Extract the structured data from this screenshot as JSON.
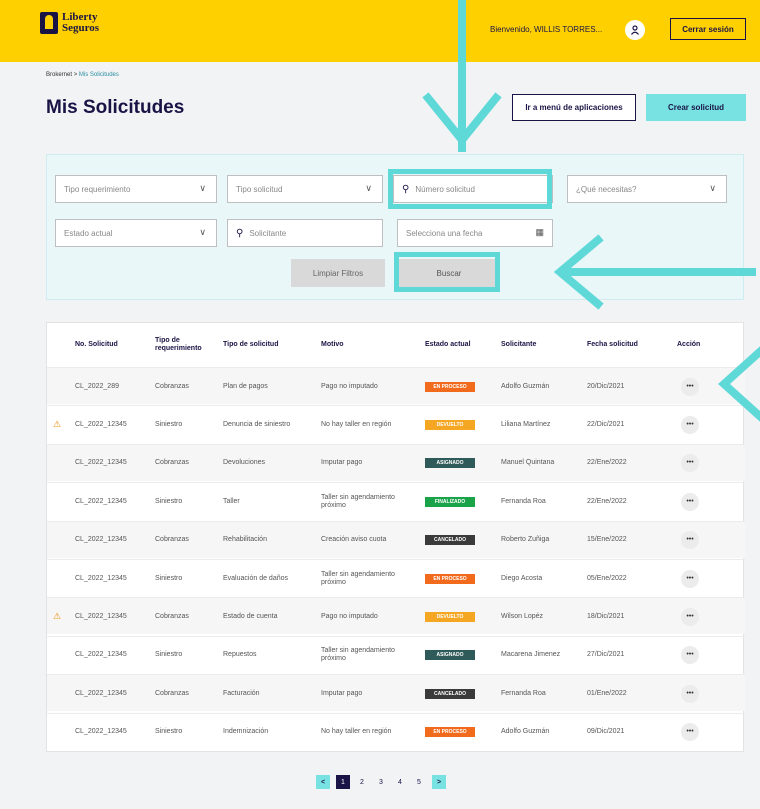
{
  "header": {
    "logo_line1": "Liberty",
    "logo_line2": "Seguros",
    "greeting": "Bienvenido, WILLIS TORRES...",
    "logout_label": "Cerrar sesión",
    "user_icon": "person-icon"
  },
  "breadcrumb": {
    "root": "Brokernet",
    "separator": ">",
    "current": "Mis Solicitudes"
  },
  "page": {
    "title": "Mis Solicitudes",
    "apps_button": "Ir a menú de aplicaciones",
    "create_button": "Crear solicitud"
  },
  "filters": {
    "tipo_requerimiento": "Tipo requerimiento",
    "tipo_solicitud": "Tipo solicitud",
    "numero_solicitud": "Número solicitud",
    "que_necesitas": "¿Qué necesitas?",
    "estado_actual": "Estado actual",
    "solicitante": "Solicitante",
    "fecha": "Selecciona una fecha",
    "clear_button": "Limpiar Filtros",
    "search_button": "Buscar"
  },
  "table": {
    "headers": {
      "no": "No. Solicitud",
      "tipo_req": "Tipo de requerimiento",
      "tipo_sol": "Tipo de solicitud",
      "motivo": "Motivo",
      "estado": "Estado actual",
      "solicitante": "Solicitante",
      "fecha": "Fecha solicitud",
      "accion": "Acción"
    },
    "rows": [
      {
        "no": "CL_2022_289",
        "req": "Cobranzas",
        "sol": "Plan de pagos",
        "motivo": "Pago no imputado",
        "estado": "EN PROCESO",
        "solicitante": "Adolfo Guzmán",
        "fecha": "20/Dic/2021",
        "warn": false
      },
      {
        "no": "CL_2022_12345",
        "req": "Siniestro",
        "sol": "Denuncia de siniestro",
        "motivo": "No hay taller en región",
        "estado": "DEVUELTO",
        "solicitante": "Liliana Martínez",
        "fecha": "22/Dic/2021",
        "warn": true
      },
      {
        "no": "CL_2022_12345",
        "req": "Cobranzas",
        "sol": "Devoluciones",
        "motivo": "Imputar pago",
        "estado": "ASIGNADO",
        "solicitante": "Manuel Quintana",
        "fecha": "22/Ene/2022",
        "warn": false
      },
      {
        "no": "CL_2022_12345",
        "req": "Siniestro",
        "sol": "Taller",
        "motivo": "Taller sin agendamiento próximo",
        "estado": "FINALIZADO",
        "solicitante": "Fernanda Roa",
        "fecha": "22/Ene/2022",
        "warn": false
      },
      {
        "no": "CL_2022_12345",
        "req": "Cobranzas",
        "sol": "Rehabilitación",
        "motivo": "Creación aviso cuota",
        "estado": "CANCELADO",
        "solicitante": "Roberto Zuñiga",
        "fecha": "15/Ene/2022",
        "warn": false
      },
      {
        "no": "CL_2022_12345",
        "req": "Siniestro",
        "sol": "Evaluación de daños",
        "motivo": "Taller sin agendamiento próximo",
        "estado": "EN PROCESO",
        "solicitante": "Diego Acosta",
        "fecha": "05/Ene/2022",
        "warn": false
      },
      {
        "no": "CL_2022_12345",
        "req": "Cobranzas",
        "sol": "Estado de cuenta",
        "motivo": "Pago no imputado",
        "estado": "DEVUELTO",
        "solicitante": "Wilson Lopéz",
        "fecha": "18/Dic/2021",
        "warn": true
      },
      {
        "no": "CL_2022_12345",
        "req": "Siniestro",
        "sol": "Repuestos",
        "motivo": "Taller sin agendamiento próximo",
        "estado": "ASIGNADO",
        "solicitante": "Macarena Jimenez",
        "fecha": "27/Dic/2021",
        "warn": false
      },
      {
        "no": "CL_2022_12345",
        "req": "Cobranzas",
        "sol": "Facturación",
        "motivo": "Imputar pago",
        "estado": "CANCELADO",
        "solicitante": "Fernanda Roa",
        "fecha": "01/Ene/2022",
        "warn": false
      },
      {
        "no": "CL_2022_12345",
        "req": "Siniestro",
        "sol": "Indemnización",
        "motivo": "No hay taller en región",
        "estado": "EN PROCESO",
        "solicitante": "Adolfo Guzmán",
        "fecha": "09/Dic/2021",
        "warn": false
      }
    ],
    "action_label": "•••"
  },
  "status_colors": {
    "EN PROCESO": "#f26b1d",
    "DEVUELTO": "#f5a623",
    "ASIGNADO": "#2f5a5a",
    "FINALIZADO": "#1ba34a",
    "CANCELADO": "#3a3a3a"
  },
  "pagination": {
    "pages": [
      "1",
      "2",
      "3",
      "4",
      "5"
    ],
    "current": "1",
    "prev": "<",
    "next": ">"
  },
  "colors": {
    "brand_yellow": "#ffd000",
    "brand_navy": "#1a1446",
    "accent_teal": "#78e1e1",
    "annotation": "#5fd8d8"
  }
}
